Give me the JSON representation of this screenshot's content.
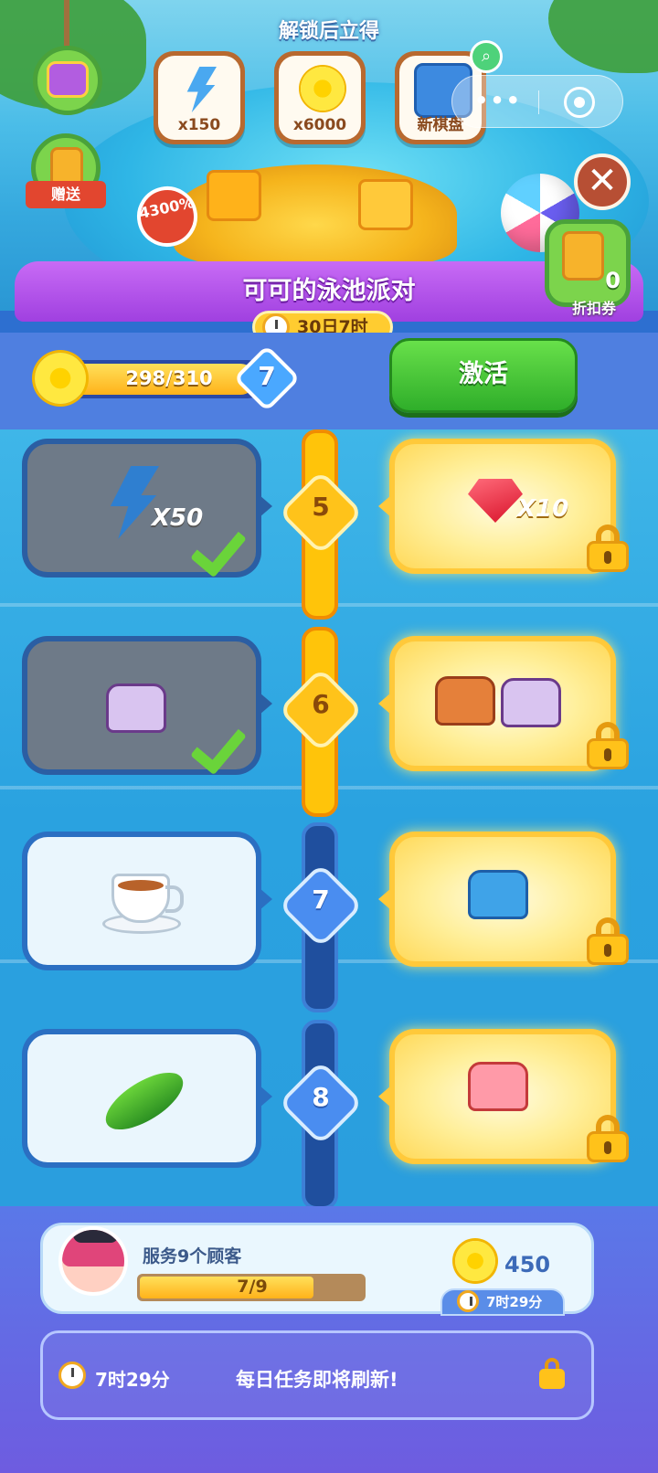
{
  "header": {
    "unlock_title": "解锁后立得",
    "rewards": [
      {
        "icon": "energy-bolt-icon",
        "label": "x150"
      },
      {
        "icon": "flower-coin-icon",
        "label": "x6000"
      },
      {
        "icon": "game-board-icon",
        "label": "新棋盘"
      }
    ],
    "gift_label": "赠送",
    "discount_badge": "4300%",
    "coupon_count": "0",
    "coupon_label": "折扣券"
  },
  "event": {
    "title": "可可的泳池派对",
    "time_left": "30日7时"
  },
  "progress": {
    "text": "298/310",
    "value": 298,
    "max": 310,
    "level": "7",
    "activate_label": "激活"
  },
  "tiers": [
    {
      "level": "5",
      "free_qty": "X50",
      "free_item": "energy-bolt-icon",
      "free_claimed": true,
      "paid_item": "ruby-icon",
      "paid_qty": "X10",
      "track_on": true
    },
    {
      "level": "6",
      "free_qty": "",
      "free_item": "purple-chest-icon",
      "free_claimed": true,
      "paid_item": "orange-and-purple-chests-icon",
      "paid_qty": "",
      "track_on": true
    },
    {
      "level": "7",
      "free_qty": "",
      "free_item": "tea-cup-icon",
      "free_claimed": false,
      "paid_item": "blue-chest-icon",
      "paid_qty": "",
      "track_on": false
    },
    {
      "level": "8",
      "free_qty": "",
      "free_item": "cucumber-icon",
      "free_claimed": false,
      "paid_item": "mystery-chest-icon",
      "paid_qty": "",
      "track_on": false
    }
  ],
  "task": {
    "title": "服务9个顾客",
    "progress_text": "7/9",
    "progress": 0.778,
    "reward": "450",
    "timer": "7时29分"
  },
  "daily": {
    "time": "7时29分",
    "message": "每日任务即将刷新!"
  }
}
